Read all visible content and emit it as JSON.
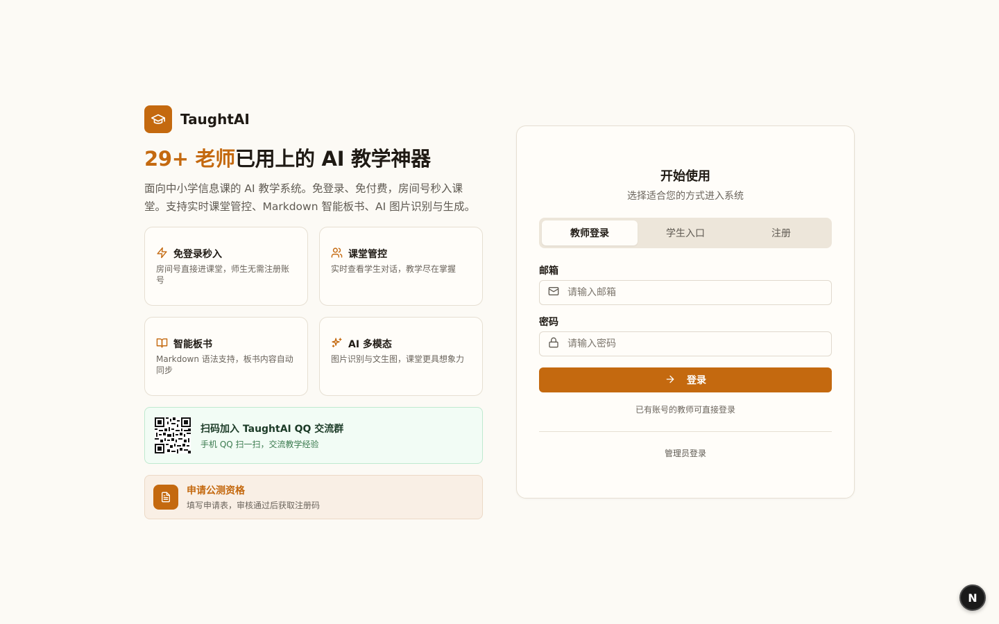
{
  "brand": {
    "name": "TaughtAI"
  },
  "hero": {
    "headline_accent": "29+ 老师",
    "headline_rest": "已用上的 AI 教学神器",
    "subtitle": "面向中小学信息课的 AI 教学系统。免登录、免付费，房间号秒入课堂。支持实时课堂管控、Markdown 智能板书、AI 图片识别与生成。"
  },
  "features": [
    {
      "icon": "zap-icon",
      "title": "免登录秒入",
      "desc": "房间号直接进课堂，师生无需注册账号"
    },
    {
      "icon": "users-icon",
      "title": "课堂管控",
      "desc": "实时查看学生对话，教学尽在掌握"
    },
    {
      "icon": "book-open-icon",
      "title": "智能板书",
      "desc": "Markdown 语法支持，板书内容自动同步"
    },
    {
      "icon": "sparkles-icon",
      "title": "AI 多模态",
      "desc": "图片识别与文生图，课堂更具想象力"
    }
  ],
  "qq": {
    "title": "扫码加入 TaughtAI QQ 交流群",
    "desc": "手机 QQ 扫一扫，交流教学经验"
  },
  "apply": {
    "title": "申请公测资格",
    "desc": "填写申请表，审核通过后获取注册码"
  },
  "card": {
    "title": "开始使用",
    "subtitle": "选择适合您的方式进入系统",
    "tabs": [
      {
        "label": "教师登录",
        "active": true
      },
      {
        "label": "学生入口",
        "active": false
      },
      {
        "label": "注册",
        "active": false
      }
    ],
    "email": {
      "label": "邮箱",
      "placeholder": "请输入邮箱",
      "value": ""
    },
    "password": {
      "label": "密码",
      "placeholder": "请输入密码",
      "value": ""
    },
    "login_button": "登录",
    "hint": "已有账号的教师可直接登录",
    "admin_link": "管理员登录"
  },
  "badge": {
    "letter": "N"
  },
  "colors": {
    "accent": "#c4690f",
    "background": "#fcfaf5",
    "qq_bg": "#f2fcf5",
    "apply_bg": "#f9efe5"
  }
}
